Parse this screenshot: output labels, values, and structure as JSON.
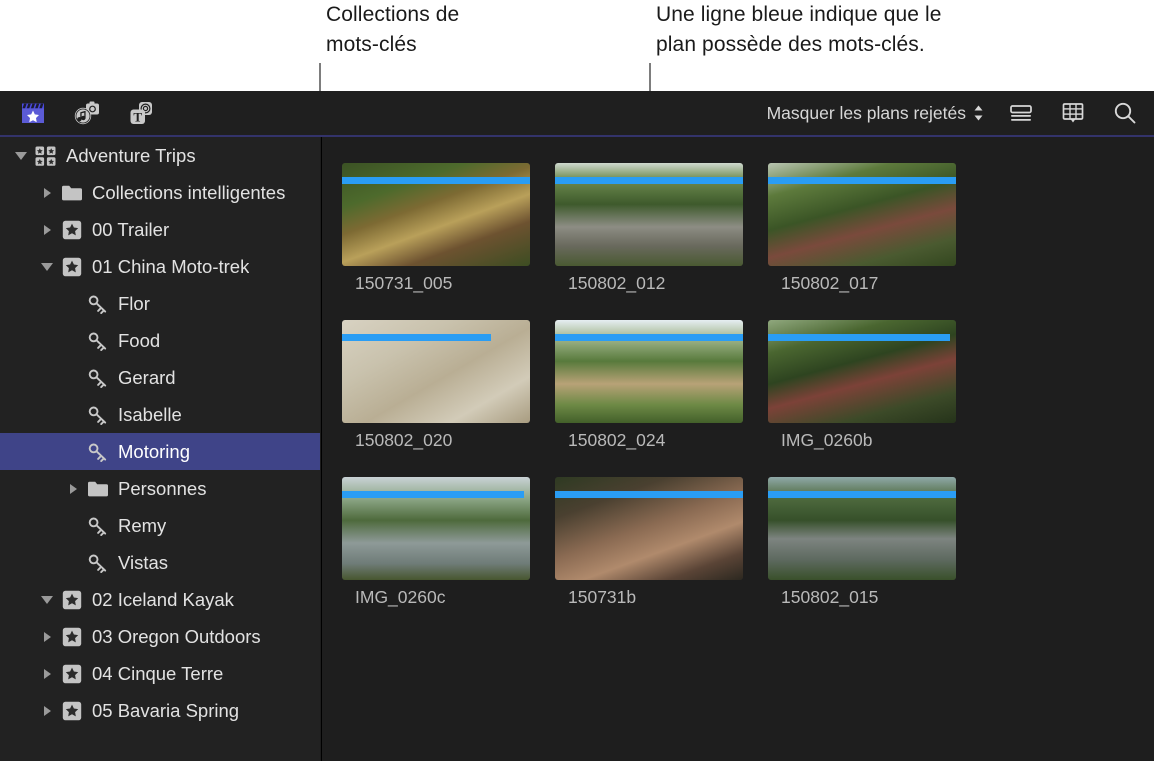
{
  "callouts": [
    {
      "id": "keyword-collections",
      "text": "Collections de\nmots-clés"
    },
    {
      "id": "blue-line",
      "text": "Une ligne bleue indique que le\nplan possède des mots-clés."
    }
  ],
  "toolbar": {
    "left_icons": [
      {
        "name": "libraries-icon",
        "label": "Bibliothèques"
      },
      {
        "name": "photos-audio-icon",
        "label": "Photos et audio"
      },
      {
        "name": "titles-generators-icon",
        "label": "Titres et générateurs"
      }
    ],
    "filter_popup": {
      "label": "Masquer les plans rejetés"
    },
    "right_icons": [
      {
        "name": "list-view-icon",
        "label": "Présentation par liste"
      },
      {
        "name": "filmstrip-view-icon",
        "label": "Présentation par vignettes"
      },
      {
        "name": "search-icon",
        "label": "Rechercher"
      }
    ]
  },
  "sidebar": {
    "items": [
      {
        "label": "Adventure Trips",
        "icon": "library-icon",
        "disclosure": "open",
        "indent": 0,
        "selected": false
      },
      {
        "label": "Collections intelligentes",
        "icon": "folder-icon",
        "disclosure": "closed",
        "indent": 1,
        "selected": false
      },
      {
        "label": "00 Trailer",
        "icon": "event-icon",
        "disclosure": "closed",
        "indent": 1,
        "selected": false
      },
      {
        "label": "01 China Moto-trek",
        "icon": "event-icon",
        "disclosure": "open",
        "indent": 1,
        "selected": false
      },
      {
        "label": "Flor",
        "icon": "keyword-icon",
        "disclosure": "none",
        "indent": 2,
        "selected": false
      },
      {
        "label": "Food",
        "icon": "keyword-icon",
        "disclosure": "none",
        "indent": 2,
        "selected": false
      },
      {
        "label": "Gerard",
        "icon": "keyword-icon",
        "disclosure": "none",
        "indent": 2,
        "selected": false
      },
      {
        "label": "Isabelle",
        "icon": "keyword-icon",
        "disclosure": "none",
        "indent": 2,
        "selected": false
      },
      {
        "label": "Motoring",
        "icon": "keyword-icon",
        "disclosure": "none",
        "indent": 2,
        "selected": true
      },
      {
        "label": "Personnes",
        "icon": "folder-icon",
        "disclosure": "closed",
        "indent": 2,
        "selected": false
      },
      {
        "label": "Remy",
        "icon": "keyword-icon",
        "disclosure": "none",
        "indent": 2,
        "selected": false
      },
      {
        "label": "Vistas",
        "icon": "keyword-icon",
        "disclosure": "none",
        "indent": 2,
        "selected": false
      },
      {
        "label": "02 Iceland Kayak",
        "icon": "event-icon",
        "disclosure": "open",
        "indent": 1,
        "selected": false
      },
      {
        "label": "03 Oregon Outdoors",
        "icon": "event-icon",
        "disclosure": "closed",
        "indent": 1,
        "selected": false
      },
      {
        "label": "04 Cinque Terre",
        "icon": "event-icon",
        "disclosure": "closed",
        "indent": 1,
        "selected": false
      },
      {
        "label": "05 Bavaria Spring",
        "icon": "event-icon",
        "disclosure": "closed",
        "indent": 1,
        "selected": false
      }
    ]
  },
  "browser": {
    "clips": [
      {
        "name": "150731_005",
        "keyword_bar": true,
        "keyword_bar_width": "100%",
        "analysis_bar": true,
        "scene": "riders-helmets"
      },
      {
        "name": "150802_012",
        "keyword_bar": true,
        "keyword_bar_width": "100%",
        "analysis_bar": false,
        "scene": "cliff-road"
      },
      {
        "name": "150802_017",
        "keyword_bar": true,
        "keyword_bar_width": "100%",
        "analysis_bar": false,
        "scene": "two-riders-red-bike"
      },
      {
        "name": "150802_020",
        "keyword_bar": true,
        "keyword_bar_width": "79%",
        "analysis_bar": false,
        "scene": "paper-map"
      },
      {
        "name": "150802_024",
        "keyword_bar": true,
        "keyword_bar_width": "100%",
        "analysis_bar": false,
        "scene": "hill-trail"
      },
      {
        "name": "IMG_0260b",
        "keyword_bar": true,
        "keyword_bar_width": "97%",
        "analysis_bar": false,
        "scene": "rider-handlebars"
      },
      {
        "name": "IMG_0260c",
        "keyword_bar": true,
        "keyword_bar_width": "97%",
        "analysis_bar": false,
        "scene": "wet-road"
      },
      {
        "name": "150731b",
        "keyword_bar": true,
        "keyword_bar_width": "100%",
        "analysis_bar": true,
        "scene": "friends-in-car"
      },
      {
        "name": "150802_015",
        "keyword_bar": true,
        "keyword_bar_width": "100%",
        "analysis_bar": false,
        "scene": "two-bikes-road"
      }
    ]
  },
  "colors": {
    "keyword_bar": "#2a9df4",
    "analysis_bar": "#6a5acd",
    "selection": "#3f4488",
    "toolbar_accent": "#33336b",
    "window_background": "#1d1d1d",
    "sidebar_background": "#222222",
    "browser_background": "#1e1e1e"
  }
}
